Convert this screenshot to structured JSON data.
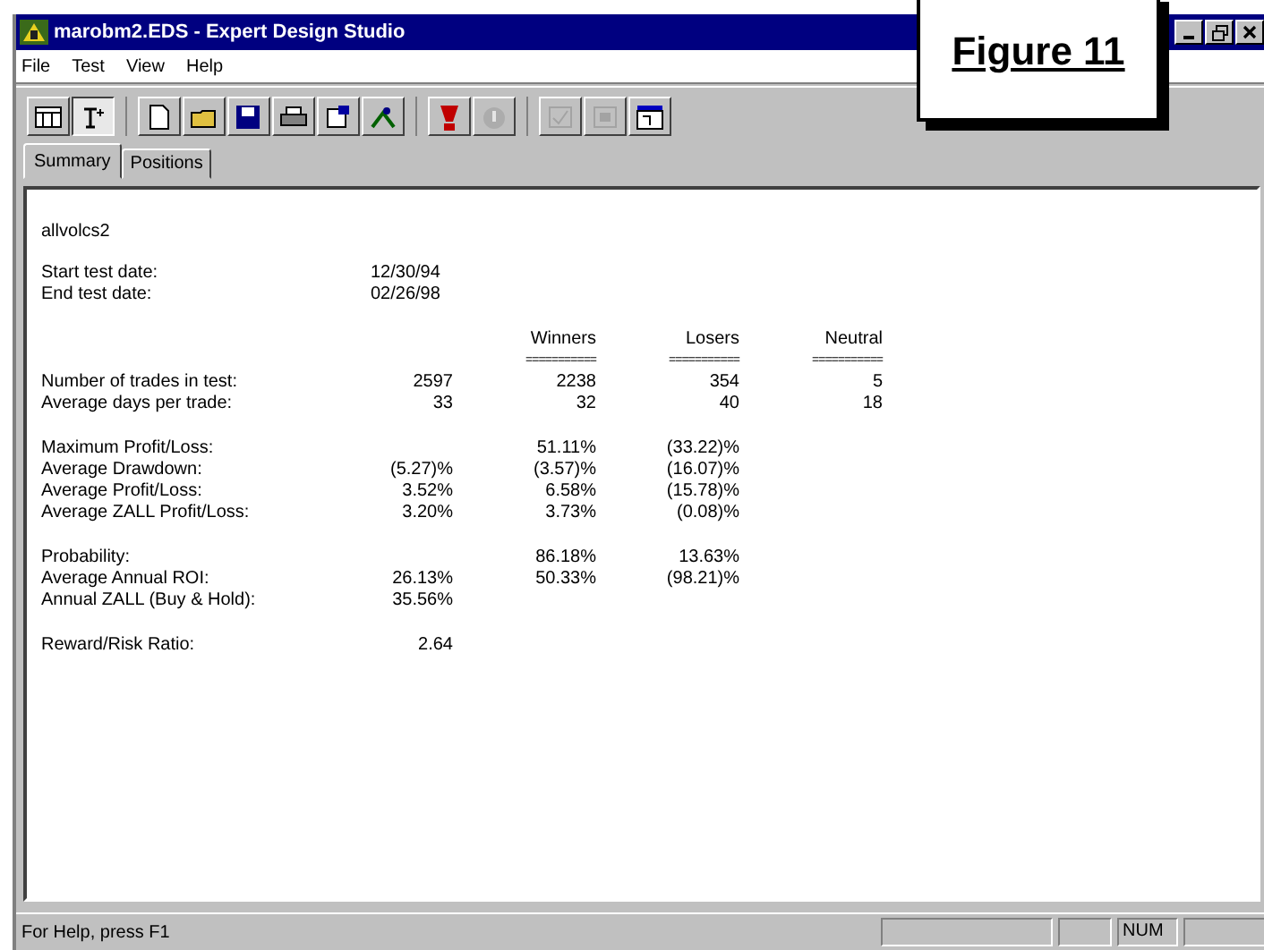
{
  "window": {
    "title": "marobm2.EDS - Expert Design Studio"
  },
  "figure_label": "Figure 11",
  "menu": [
    "File",
    "Test",
    "View",
    "Help"
  ],
  "toolbar": [
    [
      {
        "pressed": false,
        "disabled": false
      },
      {
        "pressed": true,
        "disabled": false
      }
    ],
    [
      {
        "pressed": false,
        "disabled": false
      },
      {
        "pressed": false,
        "disabled": false
      },
      {
        "pressed": false,
        "disabled": false
      },
      {
        "pressed": false,
        "disabled": false
      },
      {
        "pressed": false,
        "disabled": false
      },
      {
        "pressed": false,
        "disabled": false
      }
    ],
    [
      {
        "pressed": false,
        "disabled": false
      },
      {
        "pressed": false,
        "disabled": true
      }
    ],
    [
      {
        "pressed": false,
        "disabled": true
      },
      {
        "pressed": false,
        "disabled": true
      },
      {
        "pressed": false,
        "disabled": false
      }
    ]
  ],
  "tabs": [
    {
      "label": "Summary",
      "selected": true
    },
    {
      "label": "Positions",
      "selected": false
    }
  ],
  "report": {
    "name": "allvolcs2",
    "dates": [
      {
        "label": "Start test date:",
        "value": "12/30/94"
      },
      {
        "label": "End test date:",
        "value": "02/26/98"
      }
    ],
    "columns": [
      {
        "label": "Winners",
        "rule": "==========="
      },
      {
        "label": "Losers",
        "rule": "==========="
      },
      {
        "label": "Neutral",
        "rule": "==========="
      }
    ],
    "sections": [
      [
        {
          "label": "Number of trades in test:",
          "total": "2597",
          "cells": [
            "2238",
            "354",
            "5"
          ]
        },
        {
          "label": "Average days per trade:",
          "total": "33",
          "cells": [
            "32",
            "40",
            "18"
          ]
        }
      ],
      [
        {
          "label": "Maximum Profit/Loss:",
          "cells": [
            "51.11%",
            "(33.22)%"
          ]
        },
        {
          "label": "Average Drawdown:",
          "total": "(5.27)%",
          "cells": [
            "(3.57)%",
            "(16.07)%"
          ]
        },
        {
          "label": "Average Profit/Loss:",
          "total": "3.52%",
          "cells": [
            "6.58%",
            "(15.78)%"
          ]
        },
        {
          "label": "Average ZALL Profit/Loss:",
          "total": "3.20%",
          "cells": [
            "3.73%",
            "(0.08)%"
          ]
        }
      ],
      [
        {
          "label": "Probability:",
          "cells": [
            "86.18%",
            "13.63%"
          ]
        },
        {
          "label": "Average Annual ROI:",
          "total": "26.13%",
          "cells": [
            "50.33%",
            "(98.21)%"
          ]
        },
        {
          "label": "Annual ZALL (Buy & Hold):",
          "total": "35.56%"
        }
      ],
      [
        {
          "label": "Reward/Risk Ratio:",
          "total": "2.64"
        }
      ]
    ]
  },
  "status_bar": {
    "message": "For Help, press F1",
    "indicator": "NUM"
  }
}
